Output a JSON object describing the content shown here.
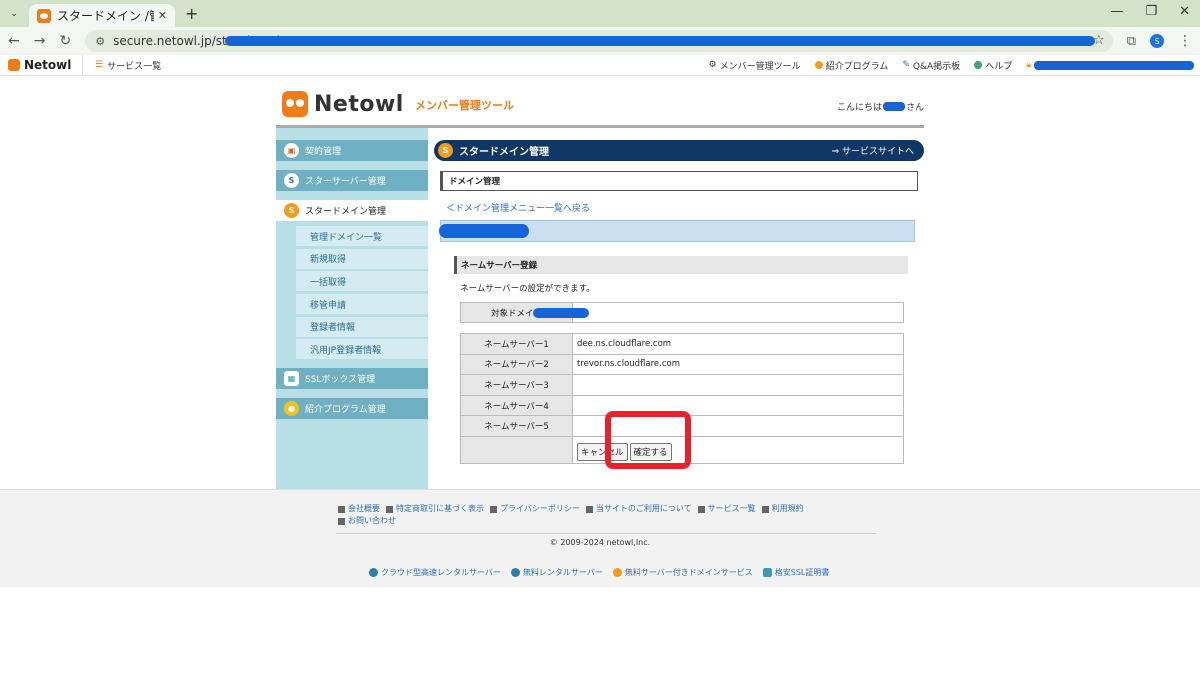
{
  "browser": {
    "tab_title": "スタードメイン /管理ツール",
    "url": "secure.netowl.jp/star-domai"
  },
  "bookmarks": {
    "logo": "Netowl",
    "service_list": "サービス一覧",
    "member_tool": "メンバー管理ツール",
    "referral": "紹介プログラム",
    "qa": "Q&A掲示板",
    "help": "ヘルプ"
  },
  "header": {
    "logo": "Netowl",
    "subtitle": "メンバー管理ツール",
    "greeting_prefix": "こんにちは",
    "greeting_suffix": "さん"
  },
  "sidebar": {
    "contract": "契約管理",
    "star_server": "スターサーバー管理",
    "star_domain": "スタードメイン管理",
    "sub_items": [
      "管理ドメイン一覧",
      "新規取得",
      "一括取得",
      "移管申請",
      "登録者情報",
      "汎用JP登録者情報"
    ],
    "ssl_box": "SSLボックス管理",
    "referral": "紹介プログラム管理"
  },
  "main": {
    "bar_title": "スタードメイン管理",
    "bar_link": "⇒ サービスサイトへ",
    "section_title": "ドメイン管理",
    "back_link": "＜ドメイン管理メニュー一覧へ戻る",
    "ns_title": "ネームサーバー登録",
    "ns_desc": "ネームサーバーの設定ができます。",
    "target_label": "対象ドメイン",
    "nameservers": [
      {
        "label": "ネームサーバー1",
        "value": "dee.ns.cloudflare.com"
      },
      {
        "label": "ネームサーバー2",
        "value": "trevor.ns.cloudflare.com"
      },
      {
        "label": "ネームサーバー3",
        "value": ""
      },
      {
        "label": "ネームサーバー4",
        "value": ""
      },
      {
        "label": "ネームサーバー5",
        "value": ""
      }
    ],
    "cancel_button": "キャンセル",
    "confirm_button": "確定する"
  },
  "footer": {
    "links": [
      "会社概要",
      "特定商取引に基づく表示",
      "プライバシーポリシー",
      "当サイトのご利用について",
      "サービス一覧",
      "利用規約",
      "お問い合わせ"
    ],
    "copyright": "© 2009-2024 netowl,Inc.",
    "services": [
      "クラウド型高速レンタルサーバー",
      "無料レンタルサーバー",
      "無料サーバー付きドメインサービス",
      "格安SSL証明書"
    ]
  },
  "colors": {
    "accent_orange": "#f07b1a",
    "nav_dark": "#0e3765",
    "sidebar": "#b8dee6",
    "annotation_red": "#e8212a"
  }
}
